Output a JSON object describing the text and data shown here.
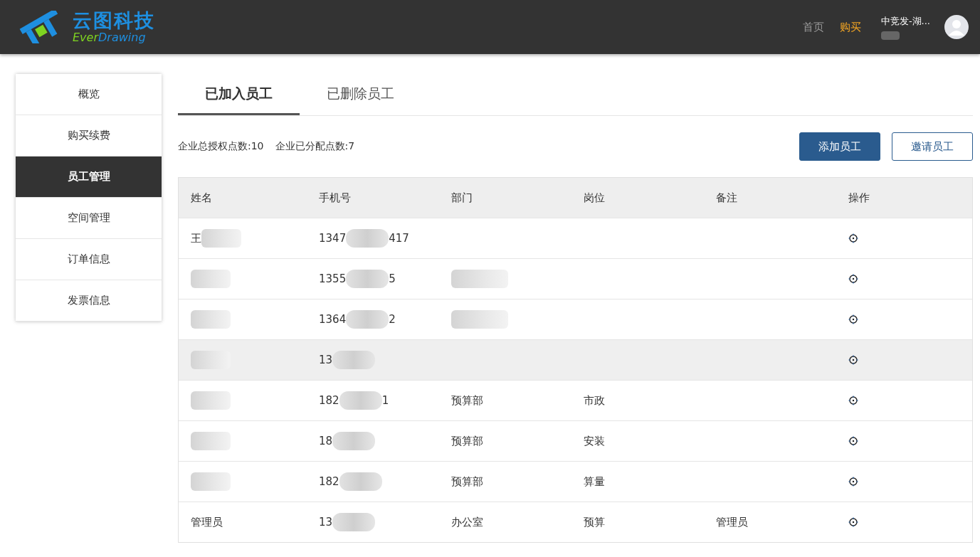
{
  "header": {
    "logo_cn": "云图科技",
    "logo_en_1": "Ever",
    "logo_en_2": "Drawing",
    "nav": [
      {
        "label": "首页",
        "selected": false
      },
      {
        "label": "购买",
        "selected": true
      }
    ],
    "user": {
      "company": "中竞发-湖...",
      "detail_blurred": true
    }
  },
  "sidebar": {
    "items": [
      {
        "label": "概览",
        "selected": false
      },
      {
        "label": "购买续费",
        "selected": false
      },
      {
        "label": "员工管理",
        "selected": true
      },
      {
        "label": "空间管理",
        "selected": false
      },
      {
        "label": "订单信息",
        "selected": false
      },
      {
        "label": "发票信息",
        "selected": false
      }
    ]
  },
  "tabs": [
    {
      "label": "已加入员工",
      "selected": true
    },
    {
      "label": "已删除员工",
      "selected": false
    }
  ],
  "summary": [
    "企业总授权点数:10",
    "企业已分配点数:7"
  ],
  "buttons": [
    {
      "label": "添加员工",
      "kind": "primary"
    },
    {
      "label": "邀请员工",
      "kind": "outline"
    }
  ],
  "table": {
    "columns": [
      "姓名",
      "手机号",
      "部门",
      "岗位",
      "备注",
      "操作"
    ],
    "rows": [
      {
        "name": "王",
        "name_blurred": true,
        "phone_start": "1347",
        "phone_end": "417",
        "highlighted": false
      },
      {
        "name_blurred": true,
        "phone_start": "1355",
        "phone_end": "5",
        "dept_blurred": true,
        "highlighted": false
      },
      {
        "name_blurred": true,
        "phone_start": "1364",
        "phone_end": "2",
        "dept_blurred": true,
        "highlighted": false
      },
      {
        "name_blurred": true,
        "phone_start": "13",
        "highlighted": true
      },
      {
        "name_blurred": true,
        "phone_start": "182",
        "phone_end": "1",
        "dept": "预算部",
        "post": "市政",
        "highlighted": false
      },
      {
        "name_blurred": true,
        "phone_start": "18",
        "dept": "预算部",
        "post": "安装",
        "highlighted": false
      },
      {
        "name_blurred": true,
        "phone_start": "182",
        "dept": "预算部",
        "post": "算量",
        "highlighted": false
      },
      {
        "name": "管理员",
        "phone_start": "13",
        "dept": "办公室",
        "post": "预算",
        "note": "管理员",
        "highlighted": false
      }
    ]
  }
}
